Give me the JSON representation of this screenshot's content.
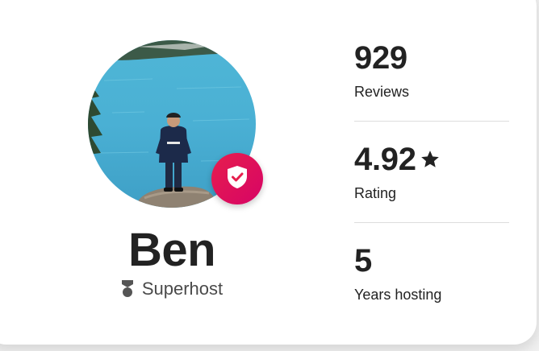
{
  "profile": {
    "name": "Ben",
    "role": "Superhost",
    "photo_description": "host-photo",
    "badge_icon": "shield-check-icon",
    "role_icon": "superhost-medal-icon"
  },
  "stats": [
    {
      "value": "929",
      "label": "Reviews",
      "icon": ""
    },
    {
      "value": "4.92",
      "label": "Rating",
      "icon": "star-icon"
    },
    {
      "value": "5",
      "label": "Years hosting",
      "icon": ""
    }
  ],
  "colors": {
    "badge": "#e61e4d",
    "text": "#222222",
    "muted": "#4a4a4a",
    "divider": "#dddddd"
  }
}
